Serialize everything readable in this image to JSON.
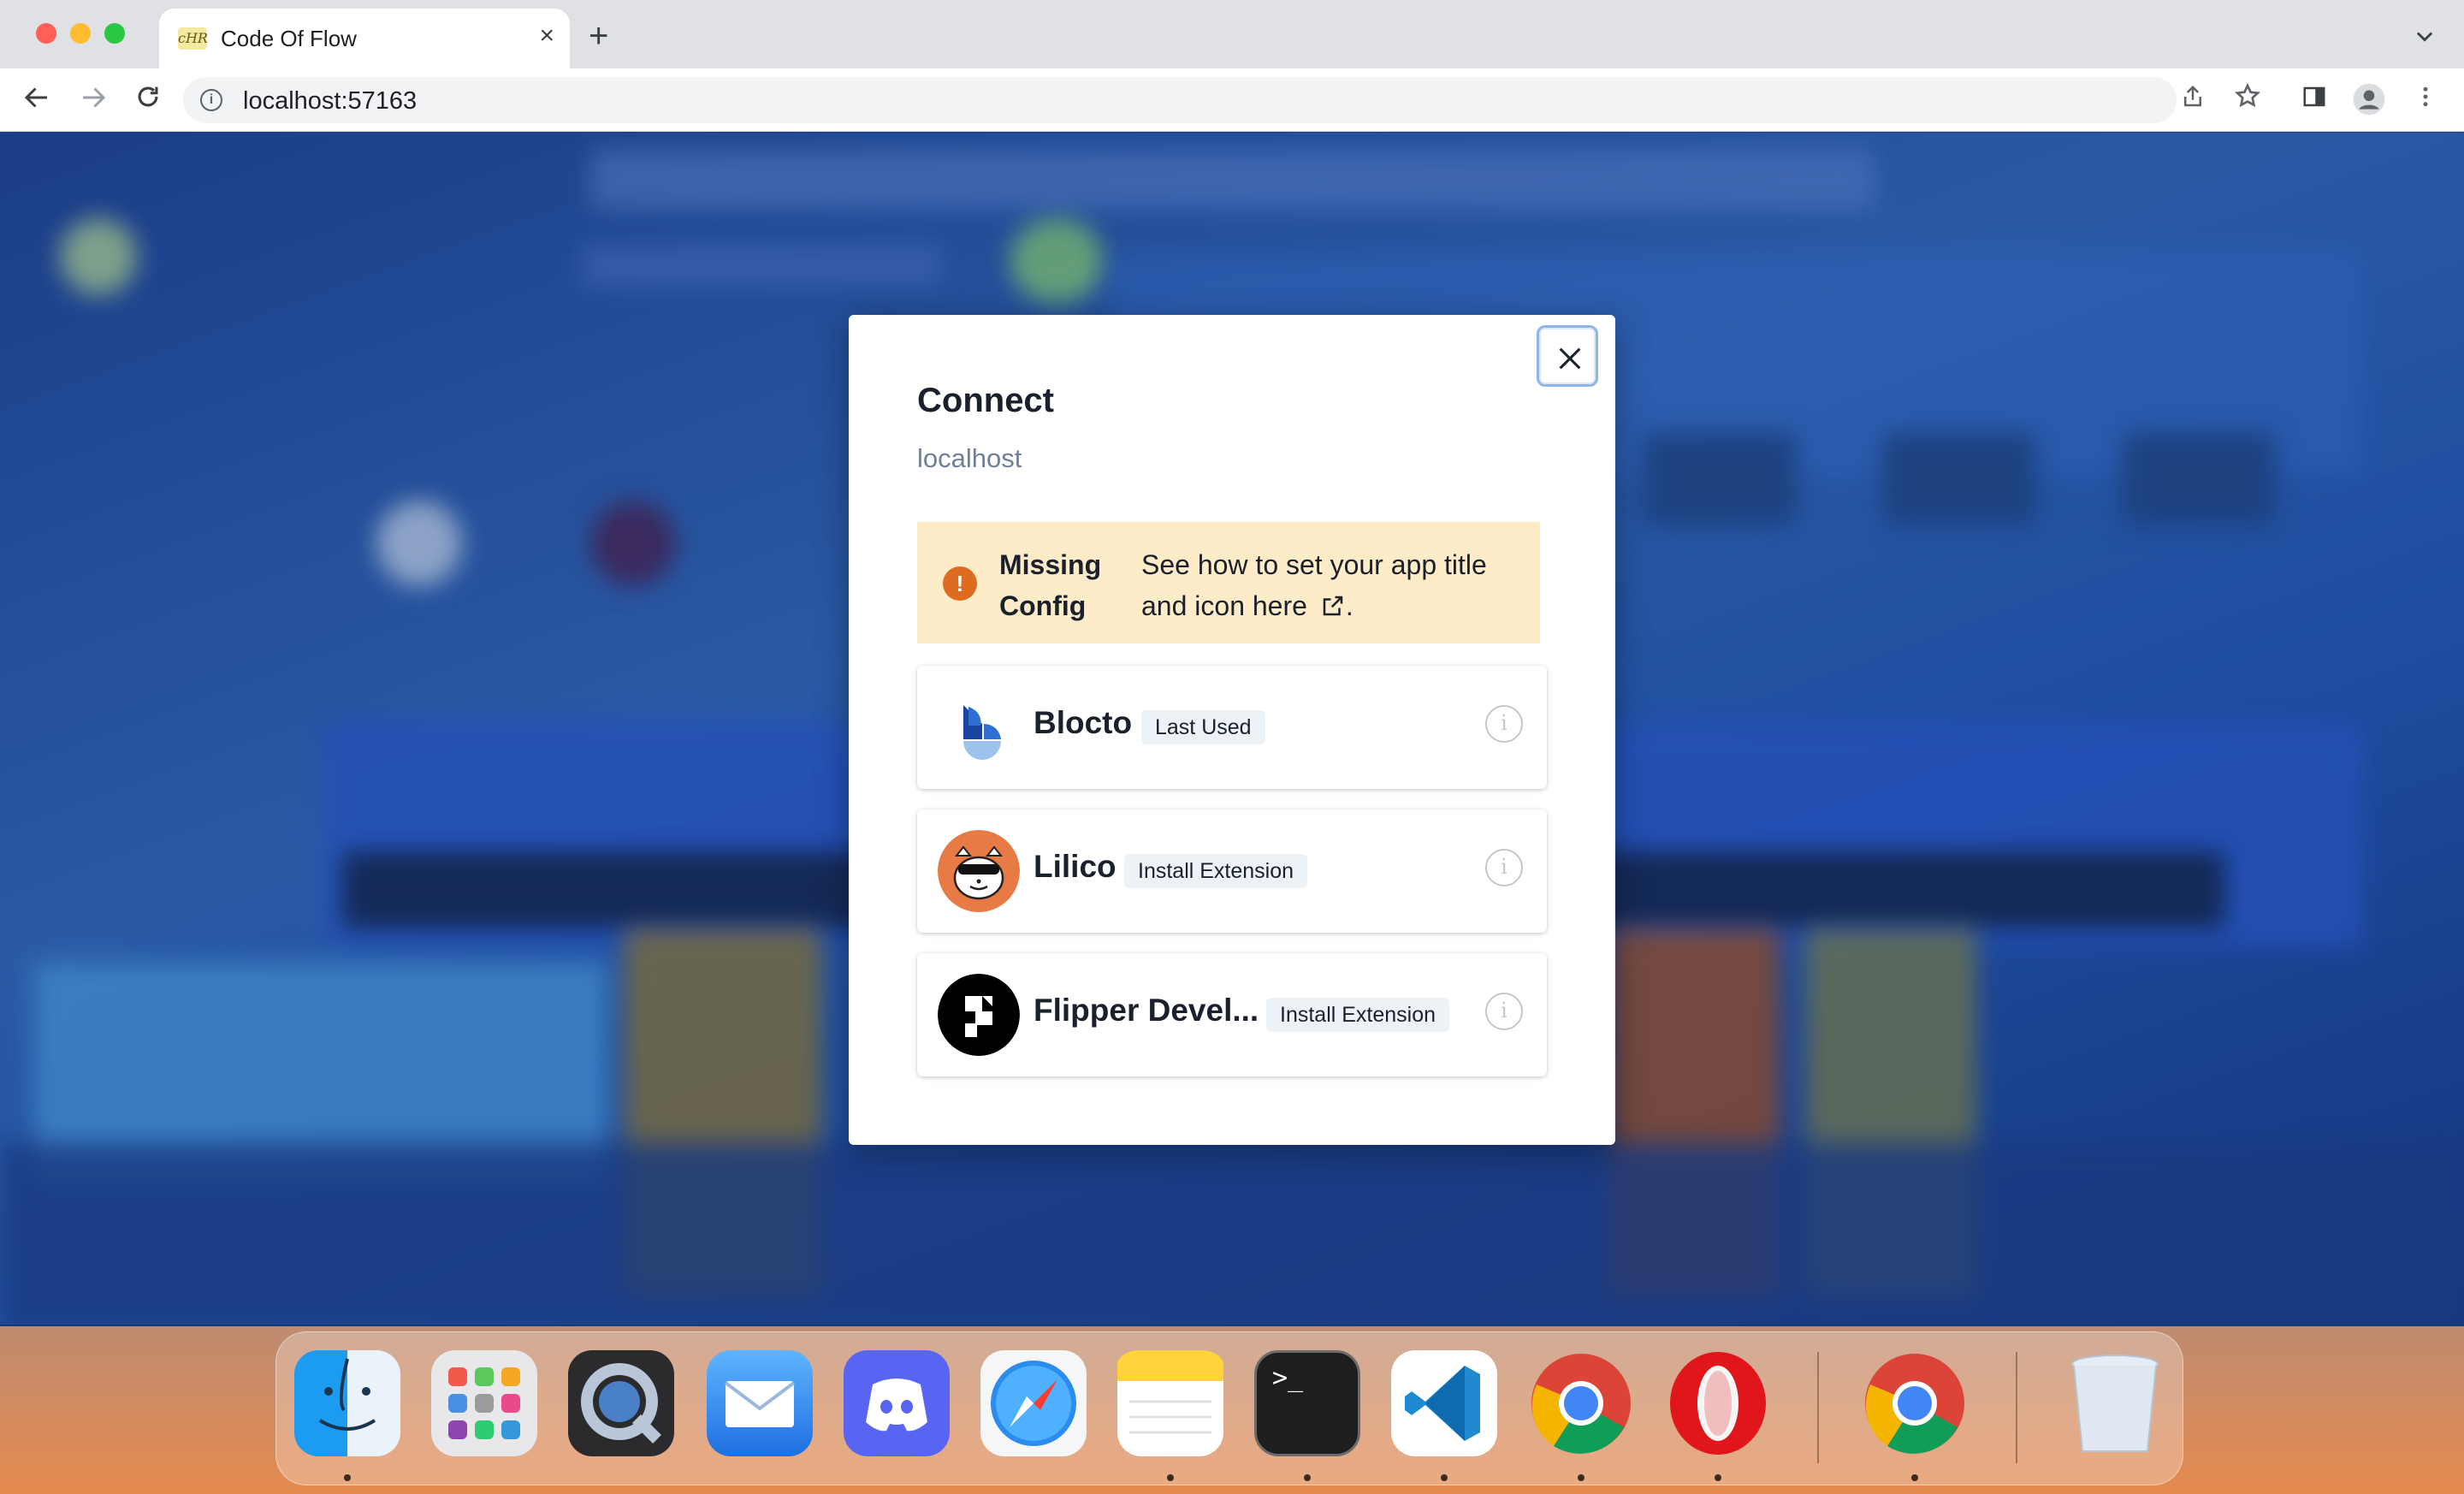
{
  "browser": {
    "tab_title": "Code Of Flow",
    "tab_close": "×",
    "new_tab": "+",
    "tab_list": "⌄",
    "favicon_text": "cHR",
    "url": "localhost:57163",
    "info_icon": "i"
  },
  "modal": {
    "title": "Connect",
    "subtitle": "localhost",
    "alert": {
      "icon": "!",
      "title": "Missing Config",
      "description": "See how to set your app title and icon here",
      "description_end": ".",
      "color": "#feebc8"
    },
    "wallets": [
      {
        "name": "Blocto",
        "badge": "Last Used",
        "info": "i"
      },
      {
        "name": "Lilico",
        "badge": "Install Extension",
        "info": "i"
      },
      {
        "name": "Flipper Devel...",
        "badge": "Install Extension",
        "info": "i"
      }
    ]
  },
  "dock": {
    "apps": [
      "finder-icon",
      "launchpad-icon",
      "quicktime-icon",
      "mail-icon",
      "discord-icon",
      "safari-icon",
      "notes-icon",
      "terminal-icon",
      "vscode-icon",
      "chrome-icon",
      "opera-icon",
      "chrome-icon",
      "trash-icon"
    ],
    "terminal_glyph": ">_"
  }
}
